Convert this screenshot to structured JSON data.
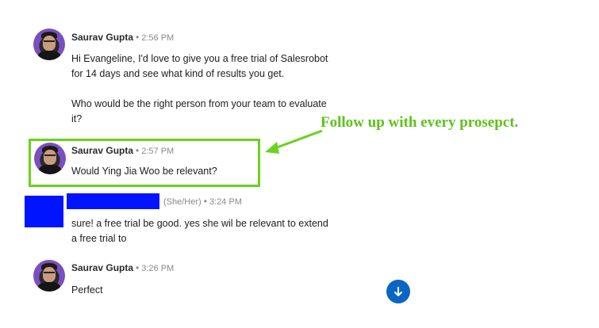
{
  "messages": [
    {
      "sender": "Saurav Gupta",
      "separator": "•",
      "time": "2:56 PM",
      "lines": [
        "Hi Evangeline, I'd love to give you a free trial of Salesrobot",
        "for 14 days and see what kind of results you get.",
        "",
        "Who would be the right person from your team to evaluate",
        "it?"
      ]
    },
    {
      "sender": "Saurav Gupta",
      "separator": "•",
      "time": "2:57 PM",
      "lines": [
        "Would Ying Jia Woo be relevant?"
      ]
    },
    {
      "sender": "",
      "pronouns": "(She/Her)",
      "separator": "•",
      "time": "3:24 PM",
      "lines": [
        "sure! a free trial be good. yes she wil be relevant to extend",
        "a free trial to"
      ]
    },
    {
      "sender": "Saurav Gupta",
      "separator": "•",
      "time": "3:26 PM",
      "lines": [
        "Perfect"
      ]
    }
  ],
  "annotation": {
    "text": "Follow up with every prosepct.",
    "color": "#5ec21a"
  },
  "colors": {
    "redaction": "#0014ff",
    "scroll_button": "#0a66c2",
    "highlight_border": "#6cd11f"
  },
  "scroll_button": {
    "icon": "arrow-down-icon",
    "glyph": "↓"
  }
}
